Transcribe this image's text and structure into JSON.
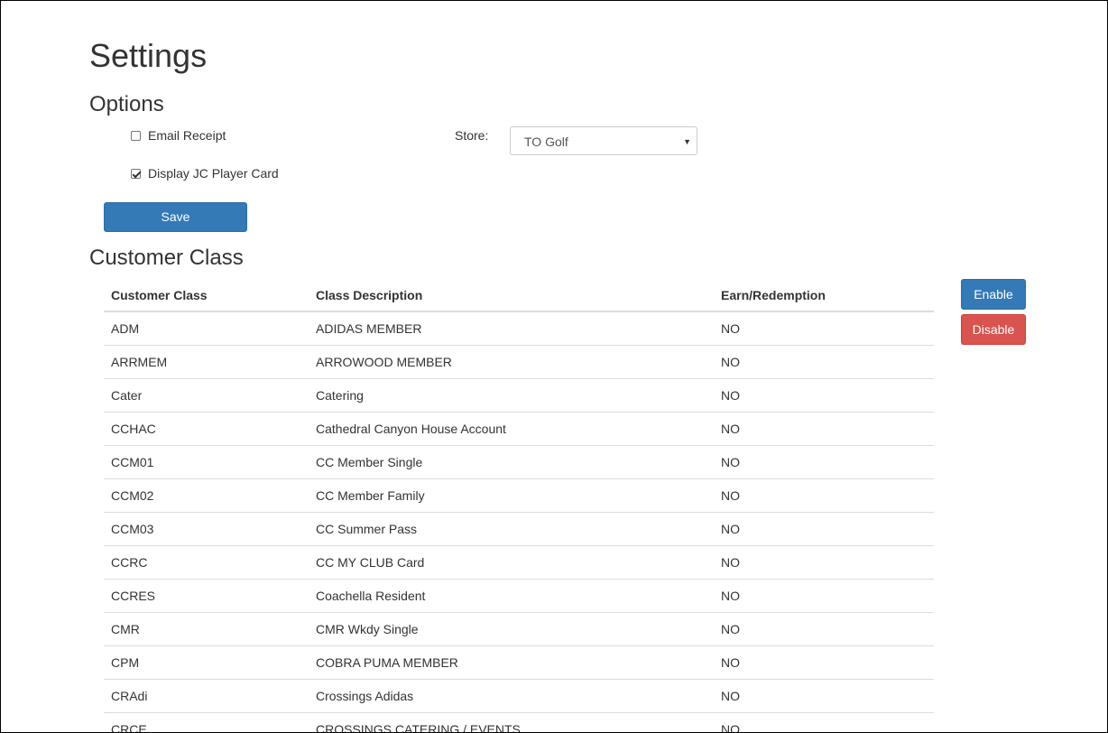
{
  "page": {
    "title": "Settings"
  },
  "options": {
    "title": "Options",
    "email_receipt": {
      "label": "Email Receipt",
      "checked": false
    },
    "display_jc_player_card": {
      "label": "Display JC Player Card",
      "checked": true
    },
    "store": {
      "label": "Store:",
      "value": "TO Golf"
    },
    "save_label": "Save"
  },
  "customer_class": {
    "title": "Customer Class",
    "columns": [
      "Customer Class",
      "Class Description",
      "Earn/Redemption"
    ],
    "rows": [
      [
        "ADM",
        "ADIDAS MEMBER",
        "NO"
      ],
      [
        "ARRMEM",
        "ARROWOOD MEMBER",
        "NO"
      ],
      [
        "Cater",
        "Catering",
        "NO"
      ],
      [
        "CCHAC",
        "Cathedral Canyon House Account",
        "NO"
      ],
      [
        "CCM01",
        "CC Member Single",
        "NO"
      ],
      [
        "CCM02",
        "CC Member Family",
        "NO"
      ],
      [
        "CCM03",
        "CC Summer Pass",
        "NO"
      ],
      [
        "CCRC",
        "CC MY CLUB Card",
        "NO"
      ],
      [
        "CCRES",
        "Coachella Resident",
        "NO"
      ],
      [
        "CMR",
        "CMR Wkdy Single",
        "NO"
      ],
      [
        "CPM",
        "COBRA PUMA MEMBER",
        "NO"
      ],
      [
        "CRAdi",
        "Crossings Adidas",
        "NO"
      ],
      [
        "CRCE",
        "CROSSINGS CATERING / EVENTS",
        "NO"
      ]
    ],
    "enable_label": "Enable",
    "disable_label": "Disable"
  },
  "colors": {
    "primary": "#337ab7",
    "danger": "#d9534f",
    "text": "#333333",
    "border": "#dddddd"
  }
}
